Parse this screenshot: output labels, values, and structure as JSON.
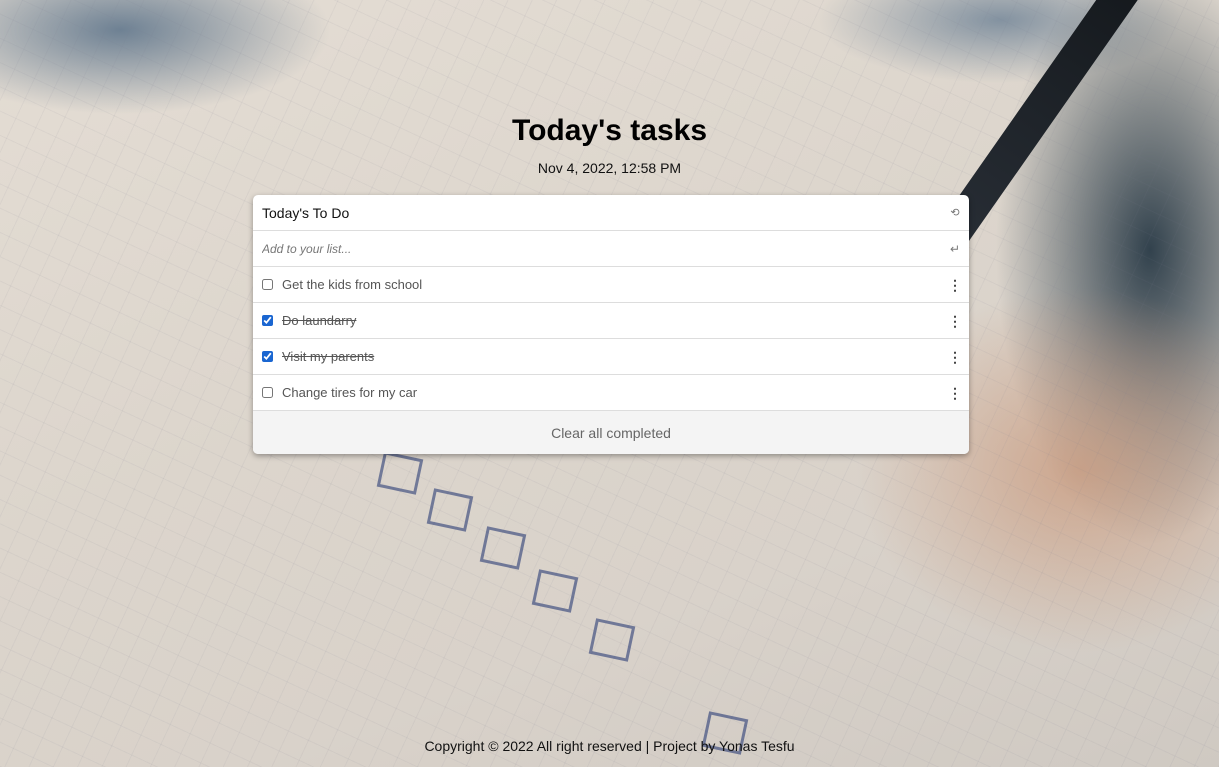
{
  "page": {
    "title": "Today's tasks",
    "datetime": "Nov 4, 2022, 12:58 PM"
  },
  "todo": {
    "header": "Today's To Do",
    "refresh_icon": "refresh-icon",
    "input_placeholder": "Add to your list...",
    "input_value": "",
    "enter_icon": "enter-icon",
    "tasks": [
      {
        "label": "Get the kids from school",
        "completed": false
      },
      {
        "label": "Do laundarry",
        "completed": true
      },
      {
        "label": "Visit my parents",
        "completed": true
      },
      {
        "label": "Change tires for my car",
        "completed": false
      }
    ],
    "clear_label": "Clear all completed",
    "checkbox_color": "#1a66d1"
  },
  "footer": {
    "text": "Copyright © 2022 All right reserved | Project by Yonas Tesfu"
  }
}
